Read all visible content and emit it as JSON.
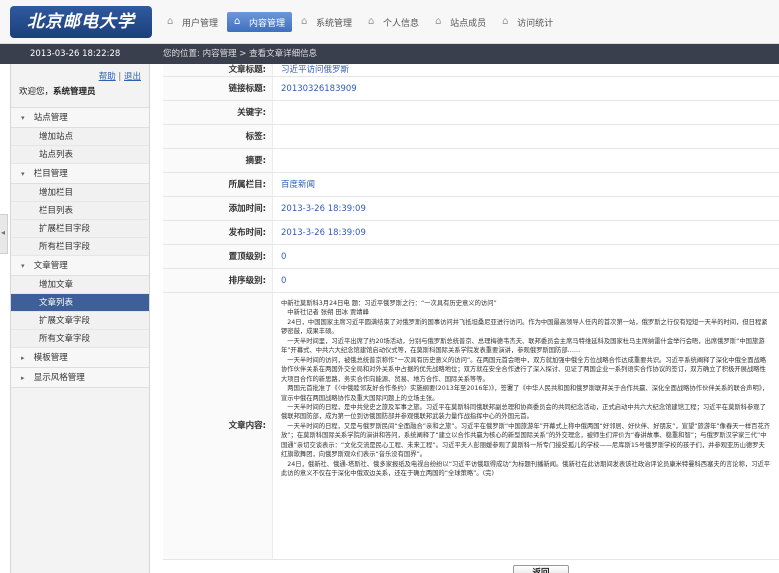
{
  "header": {
    "logo_text": "北京邮电大学",
    "nav": [
      {
        "label": "用户管理",
        "icon": "home-icon",
        "active": false
      },
      {
        "label": "内容管理",
        "icon": "home-icon",
        "active": true
      },
      {
        "label": "系统管理",
        "icon": "home-icon",
        "active": false
      },
      {
        "label": "个人信息",
        "icon": "home-icon",
        "active": false
      },
      {
        "label": "站点成员",
        "icon": "home-icon",
        "active": false
      },
      {
        "label": "访问统计",
        "icon": "home-icon",
        "active": false
      }
    ]
  },
  "datetime": "2013-03-26  18:22:28",
  "breadcrumb": "您的位置: 内容管理 > 查看文章详细信息",
  "sidebar": {
    "links": {
      "help": "帮助",
      "logout": "退出"
    },
    "welcome_prefix": "欢迎您，",
    "welcome_user": "系统管理员",
    "sections": [
      {
        "label": "站点管理",
        "expanded": true,
        "items": [
          "增加站点",
          "站点列表"
        ]
      },
      {
        "label": "栏目管理",
        "expanded": true,
        "items": [
          "增加栏目",
          "栏目列表",
          "扩展栏目字段",
          "所有栏目字段"
        ]
      },
      {
        "label": "文章管理",
        "expanded": true,
        "items": [
          "增加文章",
          "文章列表",
          "扩展文章字段",
          "所有文章字段"
        ]
      },
      {
        "label": "模板管理",
        "expanded": false,
        "items": []
      },
      {
        "label": "显示风格管理",
        "expanded": false,
        "items": []
      }
    ],
    "active_item": "文章列表"
  },
  "article": {
    "title_label": "文章标题:",
    "title": "习近平访问俄罗斯",
    "link_label": "链接标题:",
    "link": "20130326183909",
    "keywords_label": "关键字:",
    "keywords": "",
    "tags_label": "标签:",
    "tags": "",
    "summary_label": "摘要:",
    "summary": "",
    "column_label": "所属栏目:",
    "column": "百度新闻",
    "added_label": "添加时间:",
    "added": "2013-3-26 18:39:09",
    "published_label": "发布时间:",
    "published": "2013-3-26 18:39:09",
    "level_label": "置顶级别:",
    "level": "0",
    "order_label": "排序级别:",
    "order": "0",
    "content_label": "文章内容:",
    "content": [
      "中新社莫斯科3月24日电 题：习近平俄罗斯之行：“一次具有历史意义的访问”",
      "　中新社记者 张朔 田冰 贾靖峰",
      "　24日，中国国家主席习近平圆满结束了对俄罗斯的国事访问并飞抵坦桑尼亚进行访问。作为中国最高领导人任内的首次第一站，俄罗斯之行仅有短短一天半的时间，但日程紧锣密鼓，成果丰硕。",
      "　一天半时间里，习近平出席了约20场活动，分别与俄罗斯总统普京、总理梅德韦杰夫、联邦委员会主席马特维延科及国家杜马主席纳雷什金举行会晤，出席俄罗斯“中国旅游年”开幕式、中共六大纪念馆建馆启动仪式等，在莫斯科国际关系学院发表重要演讲，参观俄罗斯国防部……",
      "　一天半时间的访问，被俄总统普京称作“一次具有历史意义的访问”。在两国元首会晤中，双方就加强中俄全方位战略合作达成重要共识。习近平系统阐释了深化中俄全面战略协作伙伴关系在两国外交全局和对外关系中占据的优先战略地位；双方就在安全合作进行了深入探讨、见证了两国企业一系列语实合作协议的签订，双方确立了积极开展战略性大项目合作的新思路，务实合作向能源、贸易、地方合作、国际关系等等。",
      "　两国元首批准了《〈中俄睦邻友好合作条约〉实施纲要(2013年至2016年)》，签署了《中华人民共和国和俄罗斯联邦关于合作共赢、深化全面战略协作伙伴关系的联合声明》，宣示中俄在两国战略协作及重大国际问题上的立场主张。",
      "　一天半时间的日程，是中共党史之旅及军事之旅。习近平在莫斯科同俄联邦副总理和协商委员会的共同纪念活动，正式启动中共六大纪念馆建馆工程；习近平在莫斯科参观了俄联邦国防部，成为第一位到访俄国防部并参观俄联邦武装力量作战指挥中心的外国元首。",
      "　一天半时间的日程，又是与俄罗斯民间“全面融合”亲和之旅”。习近平在俄罗斯“中国旅游年”开幕式上称中俄两国“好邻居、好伙伴、好朋友”，宣望“旅游年”像春天一样百花齐放”；在莫斯科国际关系学院的演讲和答问，系统阐释了“建立以合作共赢为核心的新型国际关系”的外交理念，被师生们评价为“春讲故事、稳重和智”；与俄罗斯汉学家三代“中国通”亲切交谈表示：“文化交流是民心工程、未来工程”。习近平夫人彭丽媛参观了莫斯科一所专门接受孤儿的学校——尼库斯15号俄罗斯学校的孩子们，并参观亚历山德罗夫红旗歌舞团，向俄罗斯观众们表示“音乐没有国界”。",
      "　24日，俄新社、俄通-塔斯社、俄多家报纸及电视台纷纷以“习近平访俄取得成功”为标题刊播新闻。俄新社在此访期间发表该社政治评论员康米特曼科西塞夫的言论称，习近平此访的意义不仅在于深化中俄双边关系，还在于确立两国的“全球策略”。(完)"
    ]
  },
  "back_button": "返回"
}
